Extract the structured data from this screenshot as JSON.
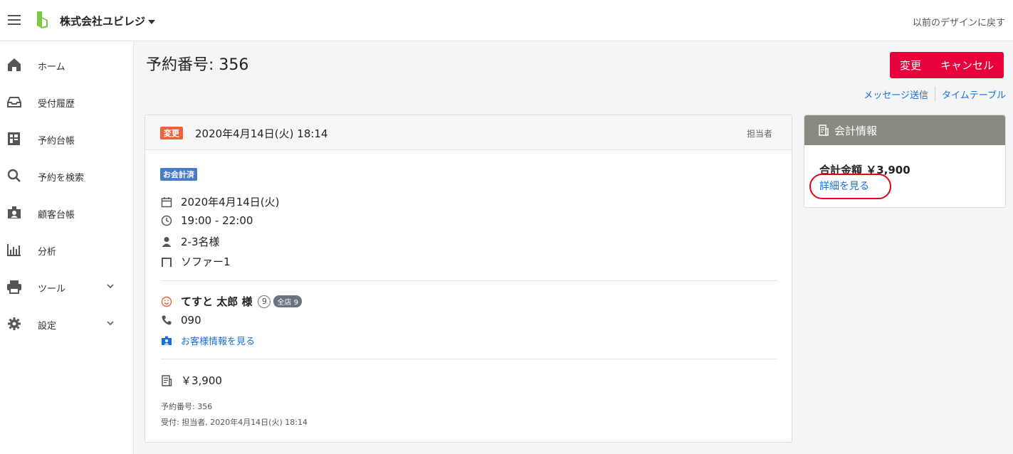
{
  "header": {
    "company": "株式会社ユビレジ",
    "prev_design_link": "以前のデザインに戻す"
  },
  "sidebar": {
    "items": [
      {
        "label": "ホーム",
        "icon": "home-icon"
      },
      {
        "label": "受付履歴",
        "icon": "inbox-icon"
      },
      {
        "label": "予約台帳",
        "icon": "ledger-icon"
      },
      {
        "label": "予約を検索",
        "icon": "search-icon"
      },
      {
        "label": "顧客台帳",
        "icon": "customer-icon"
      },
      {
        "label": "分析",
        "icon": "chart-icon"
      },
      {
        "label": "ツール",
        "icon": "printer-icon"
      },
      {
        "label": "設定",
        "icon": "gear-icon"
      }
    ]
  },
  "main": {
    "title": "予約番号: 356",
    "change_button": "変更",
    "cancel_button": "キャンセル",
    "send_message_link": "メッセージ送信",
    "timetable_link": "タイムテーブル"
  },
  "reservation": {
    "status_badge": "変更",
    "datetime": "2020年4月14日(火) 18:14",
    "staff_label": "担当者",
    "payment_badge": "お会計済",
    "date": "2020年4月14日(火)",
    "time": "19:00 - 22:00",
    "party_size": "2-3名様",
    "seat": "ソファー1",
    "customer_name": "てすと 太郎 様",
    "visit_count": "9",
    "all_store_badge": "全店 9",
    "phone": "090",
    "customer_info_link": "お客様情報を見る",
    "amount": "￥3,900",
    "reservation_number_meta": "予約番号: 356",
    "received_meta": "受付: 担当者, 2020年4月14日(火) 18:14"
  },
  "accounting": {
    "title": "会計情報",
    "total": "合計金額 ￥3,900",
    "details_link": "詳細を見る"
  },
  "colors": {
    "accent_red": "#e8003d",
    "link_blue": "#1a6fd6",
    "brand_green": "#7ac943",
    "annotation_red": "#e60012"
  }
}
